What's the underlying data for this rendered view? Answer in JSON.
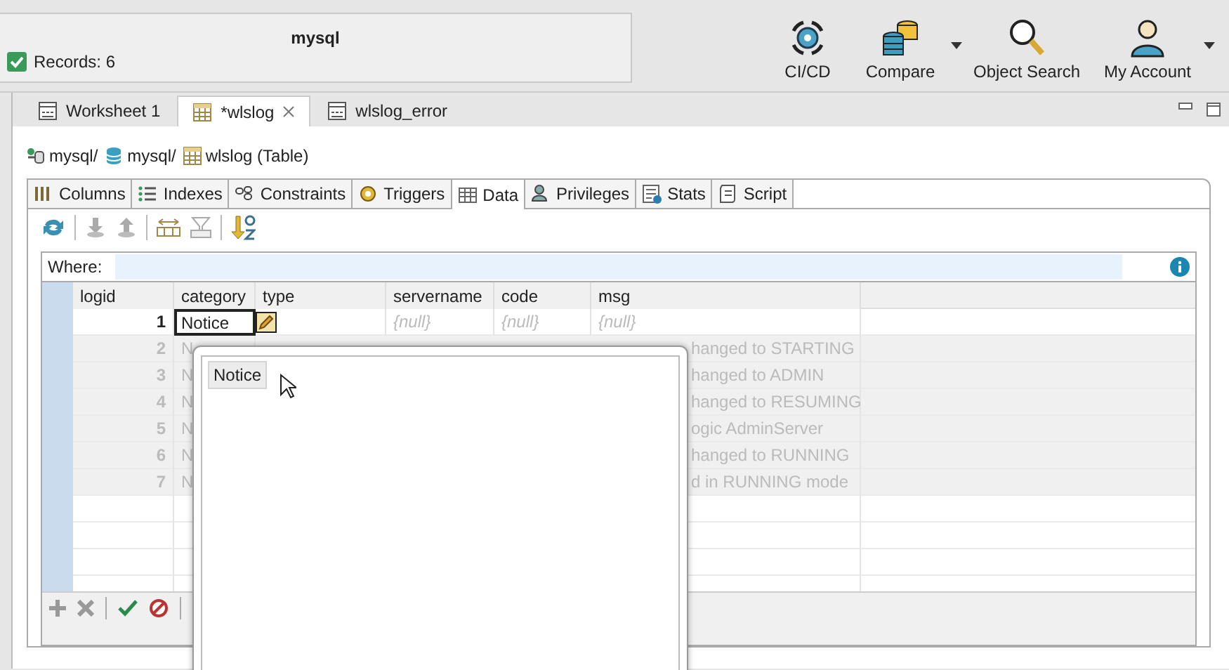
{
  "connection_panel": {
    "title": "mysql",
    "status": {
      "text": "Records: 6",
      "checked": true
    }
  },
  "toolbar": [
    {
      "label": "CI/CD",
      "kind": "cicd",
      "has_menu": false
    },
    {
      "label": "Compare",
      "kind": "compare",
      "has_menu": true
    },
    {
      "label": "Object Search",
      "kind": "search",
      "has_menu": false
    },
    {
      "label": "My Account",
      "kind": "account",
      "has_menu": true
    }
  ],
  "editor_tabs": [
    {
      "label": "Worksheet 1",
      "kind": "sql",
      "selected": false,
      "closable": false
    },
    {
      "label": "*wlslog",
      "kind": "table",
      "selected": true,
      "closable": true
    },
    {
      "label": "wlslog_error",
      "kind": "sql",
      "selected": false,
      "closable": false
    }
  ],
  "breadcrumb": [
    {
      "label": "mysql/",
      "kind": "connection"
    },
    {
      "label": "mysql/",
      "kind": "database"
    },
    {
      "label": "wlslog (Table)",
      "kind": "table"
    }
  ],
  "object_tabs": [
    {
      "label": "Columns",
      "kind": "columns",
      "selected": false
    },
    {
      "label": "Indexes",
      "kind": "indexes",
      "selected": false
    },
    {
      "label": "Constraints",
      "kind": "constraints",
      "selected": false
    },
    {
      "label": "Triggers",
      "kind": "triggers",
      "selected": false
    },
    {
      "label": "Data",
      "kind": "data",
      "selected": true
    },
    {
      "label": "Privileges",
      "kind": "privileges",
      "selected": false
    },
    {
      "label": "Stats",
      "kind": "stats",
      "selected": false
    },
    {
      "label": "Script",
      "kind": "script",
      "selected": false
    }
  ],
  "filter": {
    "label": "Where:"
  },
  "grid": {
    "columns": [
      "logid",
      "category",
      "type",
      "servername",
      "code",
      "msg"
    ],
    "rows": [
      {
        "dimmed": false,
        "cells": [
          {
            "kind": "number",
            "text": "1"
          },
          {
            "kind": "editor",
            "text": "Notice"
          },
          {
            "kind": "edit_button"
          },
          {
            "kind": "null",
            "text": "{null}"
          },
          {
            "kind": "null",
            "text": "{null}"
          },
          {
            "kind": "null",
            "text": "{null}"
          }
        ]
      },
      {
        "dimmed": true,
        "cells": [
          {
            "kind": "number",
            "text": "2"
          },
          {
            "kind": "value",
            "text": "N"
          },
          {
            "kind": "empty"
          },
          {
            "kind": "empty"
          },
          {
            "kind": "empty"
          },
          {
            "kind": "partial",
            "text": "hanged to STARTING"
          }
        ]
      },
      {
        "dimmed": true,
        "cells": [
          {
            "kind": "number",
            "text": "3"
          },
          {
            "kind": "value",
            "text": "N"
          },
          {
            "kind": "empty"
          },
          {
            "kind": "empty"
          },
          {
            "kind": "empty"
          },
          {
            "kind": "partial",
            "text": "hanged to ADMIN"
          }
        ]
      },
      {
        "dimmed": true,
        "cells": [
          {
            "kind": "number",
            "text": "4"
          },
          {
            "kind": "value",
            "text": "N"
          },
          {
            "kind": "empty"
          },
          {
            "kind": "empty"
          },
          {
            "kind": "empty"
          },
          {
            "kind": "partial",
            "text": "hanged to RESUMING"
          }
        ]
      },
      {
        "dimmed": true,
        "cells": [
          {
            "kind": "number",
            "text": "5"
          },
          {
            "kind": "value",
            "text": "N"
          },
          {
            "kind": "empty"
          },
          {
            "kind": "empty"
          },
          {
            "kind": "empty"
          },
          {
            "kind": "partial",
            "text": "ogic AdminServer"
          }
        ]
      },
      {
        "dimmed": true,
        "cells": [
          {
            "kind": "number",
            "text": "6"
          },
          {
            "kind": "value",
            "text": "N"
          },
          {
            "kind": "empty"
          },
          {
            "kind": "empty"
          },
          {
            "kind": "empty"
          },
          {
            "kind": "partial",
            "text": "hanged to RUNNING"
          }
        ]
      },
      {
        "dimmed": true,
        "cells": [
          {
            "kind": "number",
            "text": "7"
          },
          {
            "kind": "value",
            "text": "N"
          },
          {
            "kind": "empty"
          },
          {
            "kind": "empty"
          },
          {
            "kind": "empty"
          },
          {
            "kind": "partial",
            "text": "d in RUNNING mode"
          }
        ]
      }
    ]
  },
  "popup": {
    "items": [
      {
        "label": "Notice",
        "selected": true
      }
    ]
  }
}
